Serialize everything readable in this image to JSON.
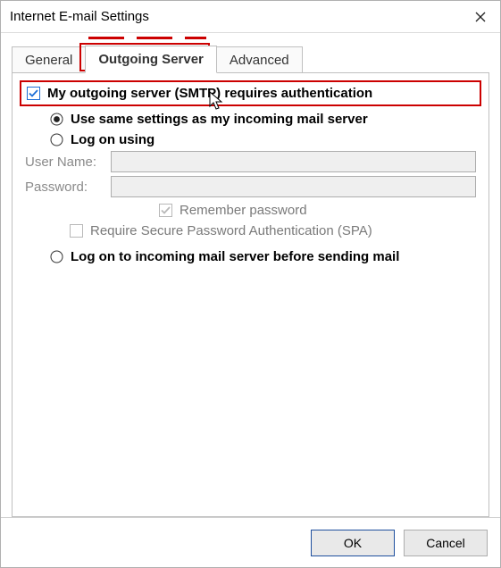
{
  "window": {
    "title": "Internet E-mail Settings"
  },
  "tabs": {
    "general": "General",
    "outgoing": "Outgoing Server",
    "advanced": "Advanced"
  },
  "main": {
    "requires_auth": "My outgoing server (SMTP) requires authentication",
    "use_same": "Use same settings as my incoming mail server",
    "log_on_using": "Log on using",
    "user_name_label": "User Name:",
    "user_name_value": "",
    "password_label": "Password:",
    "password_value": "",
    "remember_password": "Remember password",
    "require_spa": "Require Secure Password Authentication (SPA)",
    "log_on_before_send": "Log on to incoming mail server before sending mail"
  },
  "footer": {
    "ok": "OK",
    "cancel": "Cancel"
  }
}
